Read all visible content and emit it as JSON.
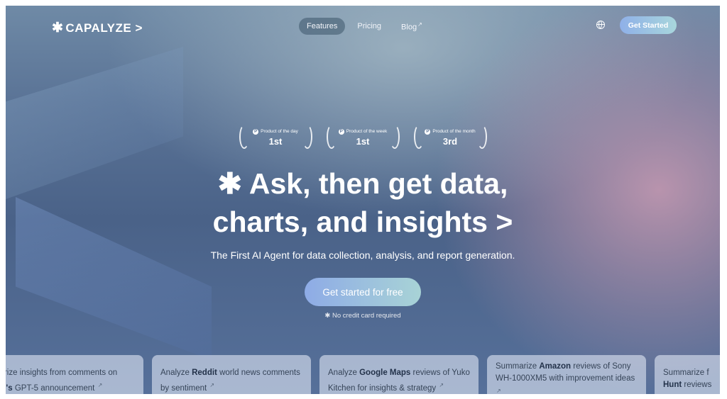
{
  "brand": {
    "name": "CAPALYZE >",
    "logo_icon": "asterisk-icon"
  },
  "nav": {
    "links": [
      "Features",
      "Pricing",
      "Blog"
    ],
    "active": "Features",
    "cta": "Get Started"
  },
  "awards": [
    {
      "label": "Product of the day",
      "rank": "1st"
    },
    {
      "label": "Product of the week",
      "rank": "1st"
    },
    {
      "label": "Product of the month",
      "rank": "3rd"
    }
  ],
  "hero": {
    "headline_line1": "Ask, then get data,",
    "headline_line2": "charts, and insights >",
    "subtitle": "The First AI Agent for data collection, analysis, and report generation.",
    "cta": "Get started for free",
    "note": "No credit card required"
  },
  "cards": [
    {
      "pre": "marize insights from comments on ",
      "bold": "nAI's",
      "post": " GPT-5 announcement"
    },
    {
      "pre": "Analyze ",
      "bold": "Reddit",
      "post": " world news comments by sentiment"
    },
    {
      "pre": "Analyze ",
      "bold": "Google Maps",
      "post": " reviews of Yuko Kitchen for insights & strategy"
    },
    {
      "pre": "Summarize ",
      "bold": "Amazon",
      "post": " reviews of Sony WH-1000XM5 with improvement ideas"
    },
    {
      "pre": "Summarize f",
      "bold": "Hunt",
      "post": " reviews"
    }
  ],
  "colors": {
    "cta_gradient_start": "#8eabe6",
    "cta_gradient_end": "#a8d3d6",
    "background_mid": "#4a6288"
  }
}
